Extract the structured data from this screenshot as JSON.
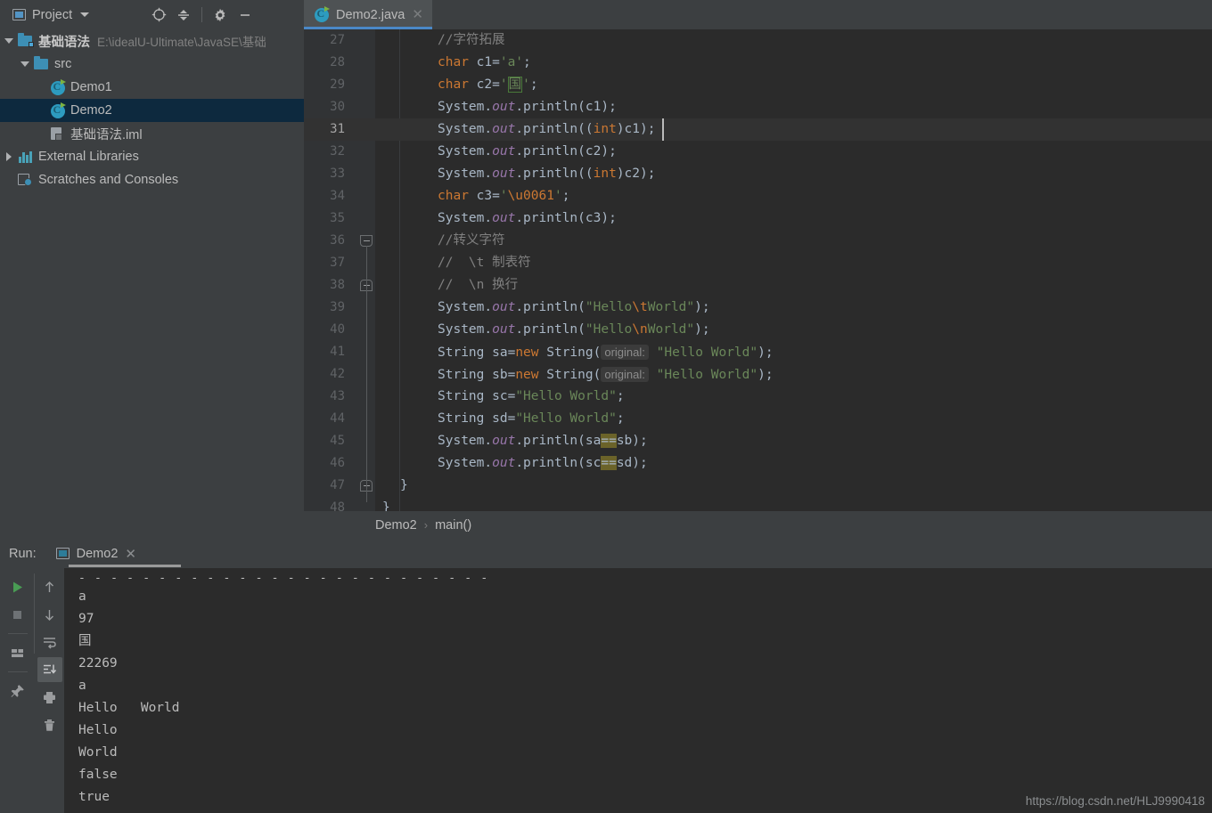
{
  "topbar": {
    "project_label": "Project",
    "icons": [
      {
        "name": "locate-icon",
        "glyph": "locate"
      },
      {
        "name": "collapse-all-icon",
        "glyph": "collapse"
      },
      {
        "name": "settings-gear-icon",
        "glyph": "gear"
      },
      {
        "name": "minimize-icon",
        "glyph": "minus"
      }
    ]
  },
  "editor_tab": {
    "label": "Demo2.java",
    "close": "✕"
  },
  "tree": {
    "items": [
      {
        "label": "基础语法",
        "path": "E:\\idealU-Ultimate\\JavaSE\\基础",
        "kind": "module",
        "indent": 0,
        "arrow": "down",
        "selected": false
      },
      {
        "label": "src",
        "path": "",
        "kind": "folder",
        "indent": 1,
        "arrow": "down",
        "selected": false
      },
      {
        "label": "Demo1",
        "path": "",
        "kind": "class",
        "indent": 2,
        "arrow": "none",
        "selected": false
      },
      {
        "label": "Demo2",
        "path": "",
        "kind": "class",
        "indent": 2,
        "arrow": "none",
        "selected": true
      },
      {
        "label": "基础语法.iml",
        "path": "",
        "kind": "iml",
        "indent": 2,
        "arrow": "none",
        "selected": false
      },
      {
        "label": "External Libraries",
        "path": "",
        "kind": "library",
        "indent": 0,
        "arrow": "right",
        "selected": false
      },
      {
        "label": "Scratches and Consoles",
        "path": "",
        "kind": "scratch",
        "indent": 0,
        "arrow": "none",
        "selected": false
      }
    ]
  },
  "code": {
    "lines": [
      {
        "n": "27",
        "current": false,
        "fold": "",
        "html": "<span class=\"cm\">//字符拓展</span>"
      },
      {
        "n": "28",
        "current": false,
        "fold": "",
        "html": "<span class=\"kw\">char</span> c1=<span class=\"st\">'a'</span>;"
      },
      {
        "n": "29",
        "current": false,
        "fold": "",
        "html": "<span class=\"kw\">char</span> c2=<span class=\"st\">'</span><span class=\"st chbox\">国</span><span class=\"st\">'</span>;"
      },
      {
        "n": "30",
        "current": false,
        "fold": "",
        "html": "System.<span class=\"fld\">out</span>.println(c1);"
      },
      {
        "n": "31",
        "current": true,
        "fold": "",
        "html": "System.<span class=\"fld\">out</span>.println((<span class=\"kw\">int</span>)c1);"
      },
      {
        "n": "32",
        "current": false,
        "fold": "",
        "html": "System.<span class=\"fld\">out</span>.println(c2);"
      },
      {
        "n": "33",
        "current": false,
        "fold": "",
        "html": "System.<span class=\"fld\">out</span>.println((<span class=\"kw\">int</span>)c2);"
      },
      {
        "n": "34",
        "current": false,
        "fold": "",
        "html": "<span class=\"kw\">char</span> c3=<span class=\"st\">'</span><span class=\"esc\">\\u0061</span><span class=\"st\">'</span>;"
      },
      {
        "n": "35",
        "current": false,
        "fold": "",
        "html": "System.<span class=\"fld\">out</span>.println(c3);"
      },
      {
        "n": "36",
        "current": false,
        "fold": "top",
        "html": "<span class=\"cm\">//转义字符</span>"
      },
      {
        "n": "37",
        "current": false,
        "fold": "",
        "html": "<span class=\"cm\">//  \\t 制表符</span>"
      },
      {
        "n": "38",
        "current": false,
        "fold": "bot",
        "html": "<span class=\"cm\">//  \\n 换行</span>"
      },
      {
        "n": "39",
        "current": false,
        "fold": "",
        "html": "System.<span class=\"fld\">out</span>.println(<span class=\"st\">\"Hello</span><span class=\"esc\">\\t</span><span class=\"st\">World\"</span>);"
      },
      {
        "n": "40",
        "current": false,
        "fold": "",
        "html": "System.<span class=\"fld\">out</span>.println(<span class=\"st\">\"Hello</span><span class=\"esc\">\\n</span><span class=\"st\">World\"</span>);"
      },
      {
        "n": "41",
        "current": false,
        "fold": "",
        "html": "String sa=<span class=\"kw\">new</span> String(<span class=\"hint\">original:</span> <span class=\"st\">\"Hello World\"</span>);"
      },
      {
        "n": "42",
        "current": false,
        "fold": "",
        "html": "String sb=<span class=\"kw\">new</span> String(<span class=\"hint\">original:</span> <span class=\"st\">\"Hello World\"</span>);"
      },
      {
        "n": "43",
        "current": false,
        "fold": "",
        "html": "String sc=<span class=\"st\">\"Hello World\"</span>;"
      },
      {
        "n": "44",
        "current": false,
        "fold": "",
        "html": "String sd=<span class=\"st\">\"Hello World\"</span>;"
      },
      {
        "n": "45",
        "current": false,
        "fold": "",
        "html": "System.<span class=\"fld\">out</span>.println(sa<span class=\"eqhl\">==</span>sb);"
      },
      {
        "n": "46",
        "current": false,
        "fold": "",
        "html": "System.<span class=\"fld\">out</span>.println(sc<span class=\"eqhl\">==</span>sd);"
      },
      {
        "n": "47",
        "current": false,
        "fold": "bot",
        "html": "}"
      },
      {
        "n": "48",
        "current": false,
        "fold": "",
        "html": "}"
      }
    ]
  },
  "breadcrumb": {
    "items": [
      "Demo2",
      "main()"
    ],
    "separator": "›"
  },
  "run_panel": {
    "run_label": "Run:",
    "tab_label": "Demo2",
    "tab_close": "✕",
    "left_tools": [
      {
        "name": "rerun-icon",
        "glyph": "play"
      },
      {
        "name": "stop-icon",
        "glyph": "stop"
      },
      {
        "name": "layout-icon",
        "glyph": "layout"
      },
      {
        "name": "pin-icon",
        "glyph": "pin"
      }
    ],
    "right_tools": [
      {
        "name": "up-arrow-icon",
        "glyph": "up"
      },
      {
        "name": "down-arrow-icon",
        "glyph": "down"
      },
      {
        "name": "soft-wrap-icon",
        "glyph": "wrap"
      },
      {
        "name": "scroll-to-end-icon",
        "glyph": "scrollend"
      },
      {
        "name": "print-icon",
        "glyph": "print"
      },
      {
        "name": "trash-icon",
        "glyph": "trash"
      }
    ],
    "separator_line": "- - - - - - - - - - - - - - - - - - - - - - - - - -",
    "output": [
      "a",
      "97",
      "国",
      "22269",
      "a",
      "Hello\tWorld",
      "Hello",
      "World",
      "false",
      "true"
    ]
  },
  "watermark": "https://blog.csdn.net/HLJ9990418",
  "colors": {
    "panel_bg": "#3c3f41",
    "editor_bg": "#2b2b2b",
    "gutter_bg": "#313335",
    "selection_bg": "#0d293e",
    "tab_accent": "#4a88c7",
    "keyword": "#cc7832",
    "string": "#6a8759",
    "comment": "#808080",
    "field": "#9876aa",
    "text": "#a9b7c6",
    "highlight": "#6b6329"
  }
}
